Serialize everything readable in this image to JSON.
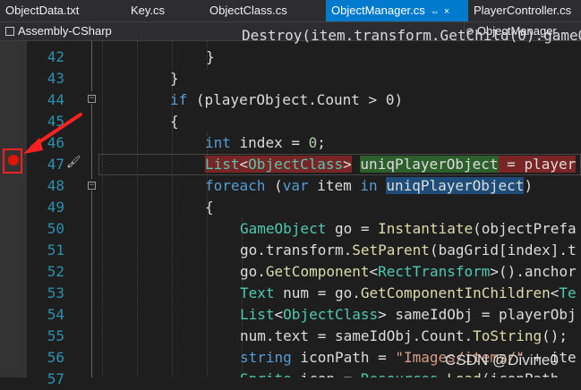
{
  "tabs": [
    {
      "label": "ObjectData.txt"
    },
    {
      "label": "Key.cs"
    },
    {
      "label": "ObjectClass.cs"
    },
    {
      "label": "ObjectManager.cs",
      "pin": "⇔",
      "close": "×"
    },
    {
      "label": "PlayerController.cs"
    }
  ],
  "nav": {
    "project": "Assembly-CSharp",
    "class": "ObjectManager"
  },
  "lines": [
    {
      "n": "42"
    },
    {
      "n": "43"
    },
    {
      "n": "44"
    },
    {
      "n": "45"
    },
    {
      "n": "46"
    },
    {
      "n": "47"
    },
    {
      "n": "48"
    },
    {
      "n": "49"
    },
    {
      "n": "50"
    },
    {
      "n": "51"
    },
    {
      "n": "52"
    },
    {
      "n": "53"
    },
    {
      "n": "54"
    },
    {
      "n": "55"
    },
    {
      "n": "56"
    },
    {
      "n": "57"
    }
  ],
  "code": {
    "l41": "Destroy(item.transform.GetChild(0).gameO",
    "l42": "}",
    "l43": "}",
    "l44": {
      "kw": "if",
      "rest": " (playerObject.Count > 0)"
    },
    "l45": "{",
    "l46": {
      "kw": "int",
      "rest": " index = ",
      "num": "0",
      "end": ";"
    },
    "l47": {
      "a": "List",
      "lt": "<",
      "b": "ObjectClass",
      "gt": ">",
      "sp": " ",
      "var": "uniqPlayerObject",
      "rest": " = player"
    },
    "l48": {
      "kw": "foreach",
      "open": " (",
      "kw2": "var",
      "mid": " item ",
      "kw3": "in",
      "sp": " ",
      "var": "uniqPlayerObject",
      "close": ")"
    },
    "l49": "{",
    "l50": {
      "ty": "GameObject",
      "mid": " go = ",
      "fn": "Instantiate",
      "rest": "(objectPrefa"
    },
    "l51": {
      "a": "go.transform.",
      "fn": "SetParent",
      "rest": "(bagGrid[index].t"
    },
    "l52": {
      "a": "go.",
      "fn": "GetComponent",
      "lt": "<",
      "ty": "RectTransform",
      "rest": ">().anchor"
    },
    "l53": {
      "ty": "Text",
      "mid": " num = go.",
      "fn": "GetComponentInChildren",
      "lt": "<",
      "ty2": "Te"
    },
    "l54": {
      "ty": "List",
      "lt": "<",
      "ty2": "ObjectClass",
      "mid": "> sameIdObj = playerObj"
    },
    "l55": {
      "a": "num.text = sameIdObj.Count.",
      "fn": "ToString",
      "rest": "();"
    },
    "l56": {
      "kw": "string",
      "mid": " iconPath = ",
      "str": "\"Images/items/\"",
      "rest": " + ite"
    },
    "l57": {
      "ty": "Sprite",
      "mid": " icon = ",
      "ty2": "Resources",
      "dot": ".",
      "fn": "Load",
      "rest": "(iconPath"
    }
  },
  "watermark": "CSDN @Divine0",
  "colors": {
    "breakpoint": "#e51400",
    "annotation": "#ff2020",
    "active_tab": "#007acc"
  }
}
